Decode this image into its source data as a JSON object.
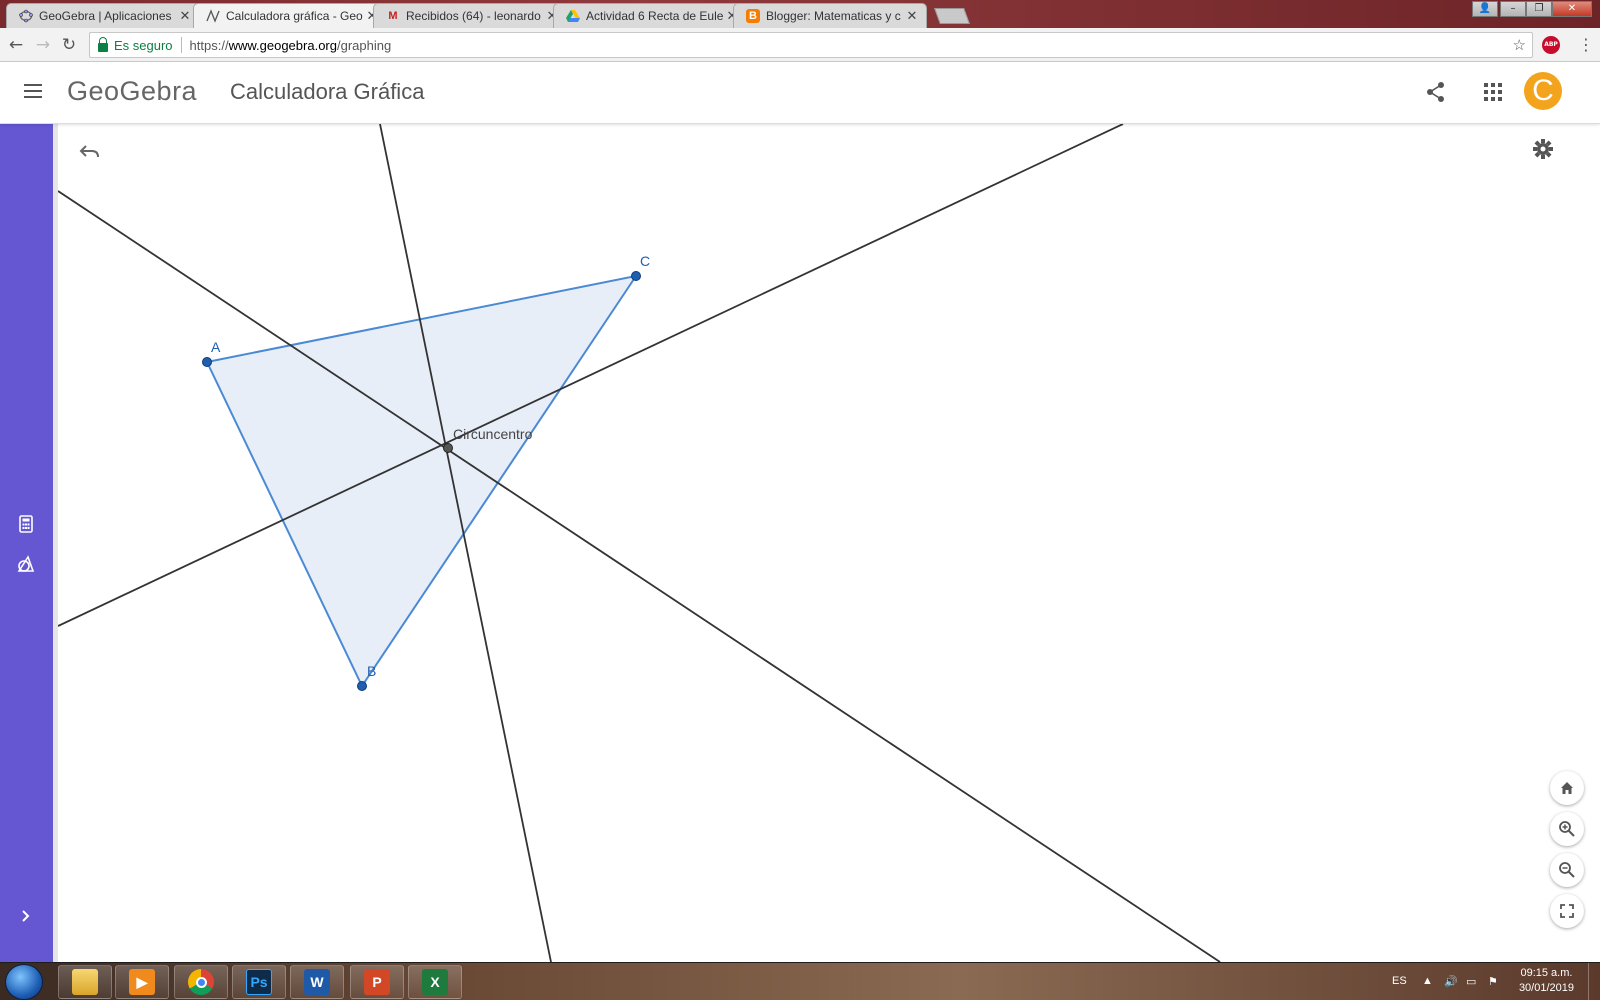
{
  "browser": {
    "tabs": [
      {
        "label": "GeoGebra | Aplicaciones",
        "active": false,
        "favicon": "geogebra-icon"
      },
      {
        "label": "Calculadora gráfica - Geo",
        "active": true,
        "favicon": "graphing-icon"
      },
      {
        "label": "Recibidos (64) - leonardo",
        "active": false,
        "favicon": "gmail-icon"
      },
      {
        "label": "Actividad 6 Recta de Eule",
        "active": false,
        "favicon": "drive-icon"
      },
      {
        "label": "Blogger: Matematicas y c",
        "active": false,
        "favicon": "blogger-icon"
      }
    ],
    "secure_label": "Es seguro",
    "url": {
      "scheme": "https://",
      "host": "www.geogebra.org",
      "path": "/graphing"
    },
    "extension_badge": "ABP"
  },
  "app": {
    "logo": "GeoGebra",
    "title": "Calculadora Gráfica",
    "avatar_initial": "C",
    "accent_color": "#6557d2",
    "avatar_color": "#f4a31c"
  },
  "graph": {
    "triangle_color": "#4a8ad4",
    "line_color": "#333333",
    "points": {
      "A": "A",
      "B": "B",
      "C": "C"
    },
    "center_label": "Circuncentro"
  },
  "taskbar": {
    "apps": [
      {
        "name": "explorer",
        "color": "#e8b33a",
        "glyph": ""
      },
      {
        "name": "media-player",
        "color": "#f08a1c",
        "glyph": "▶"
      },
      {
        "name": "chrome",
        "color": "#ffffff",
        "glyph": ""
      },
      {
        "name": "photoshop",
        "color": "#0f2b4a",
        "glyph": "Ps"
      },
      {
        "name": "word",
        "color": "#1f5aa8",
        "glyph": "W"
      },
      {
        "name": "powerpoint",
        "color": "#d24726",
        "glyph": "P"
      },
      {
        "name": "excel",
        "color": "#1f7a3d",
        "glyph": "X"
      }
    ],
    "language": "ES",
    "time": "09:15 a.m.",
    "date": "30/01/2019"
  }
}
